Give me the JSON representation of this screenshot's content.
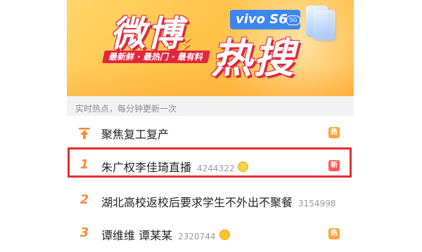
{
  "banner": {
    "title_part1": "微博",
    "title_part2": "热搜",
    "tagline": "最新鲜 · 最热门 · 最有料",
    "brand": "vivo S6",
    "brand_badge": "5G"
  },
  "section": {
    "header": "实时热点，每分钟更新一次"
  },
  "list": [
    {
      "rank": "",
      "icon": "pin-up-icon",
      "title": "聚焦复工复产",
      "count": "",
      "emoji": "",
      "badge": "热",
      "badge_color": "#f7a73a"
    },
    {
      "rank": "1",
      "icon": "",
      "title": "朱广权李佳琦直播",
      "count": "4244322",
      "emoji": "cat-emoji-icon",
      "badge": "新",
      "badge_color": "#ff5b5b"
    },
    {
      "rank": "2",
      "icon": "",
      "title": "湖北高校返校后要求学生不外出不聚餐",
      "count": "3154998",
      "emoji": "",
      "badge": "",
      "badge_color": ""
    },
    {
      "rank": "3",
      "icon": "",
      "title": "谭维维 谭某某",
      "count": "2320744",
      "emoji": "smile-emoji-icon",
      "badge": "热",
      "badge_color": "#f7a73a"
    }
  ],
  "colors": {
    "accent_orange": "#ff8a3d",
    "highlight_red": "#e02f2f",
    "banner_red": "#e0273f"
  }
}
